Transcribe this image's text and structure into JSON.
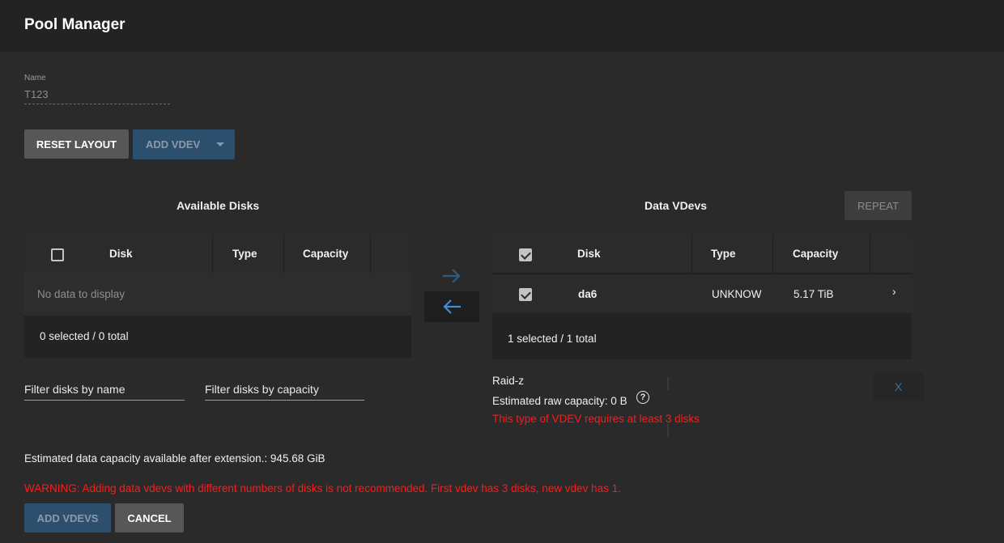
{
  "header": {
    "title": "Pool Manager"
  },
  "name_field": {
    "label": "Name",
    "value": "T123"
  },
  "toolbar": {
    "reset_layout": "RESET LAYOUT",
    "add_vdev": "ADD VDEV"
  },
  "available": {
    "title": "Available Disks",
    "columns": [
      "Disk",
      "Type",
      "Capacity"
    ],
    "empty_message": "No data to display",
    "footer": "0 selected / 0 total",
    "filter_name": "Filter disks by name",
    "filter_capacity": "Filter disks by capacity"
  },
  "vdevs": {
    "title": "Data VDevs",
    "repeat_label": "REPEAT",
    "columns": [
      "Disk",
      "Type",
      "Capacity"
    ],
    "rows": [
      {
        "disk": "da6",
        "type": "UNKNOW",
        "capacity": "5.17 TiB",
        "checked": true,
        "expand": "›"
      }
    ],
    "footer": "1 selected / 1 total",
    "raid_type": "Raid-z",
    "raw_capacity": "Estimated raw capacity: 0 B",
    "help_icon": "?",
    "error": "This type of VDEV requires at least 3 disks",
    "remove_label": "X"
  },
  "summary": {
    "estimated": "Estimated data capacity available after extension.: 945.68 GiB",
    "warning": "WARNING: Adding data vdevs with different numbers of disks is not recommended. First vdev has 3 disks, new vdev has 1."
  },
  "actions": {
    "add_vdevs": "ADD VDEVS",
    "cancel": "CANCEL"
  },
  "colors": {
    "background": "#2a2a2a",
    "header": "#232323",
    "primary": "#2c4f6e",
    "arrow_accent": "#3d8fd6",
    "error": "#ff1a1a"
  }
}
